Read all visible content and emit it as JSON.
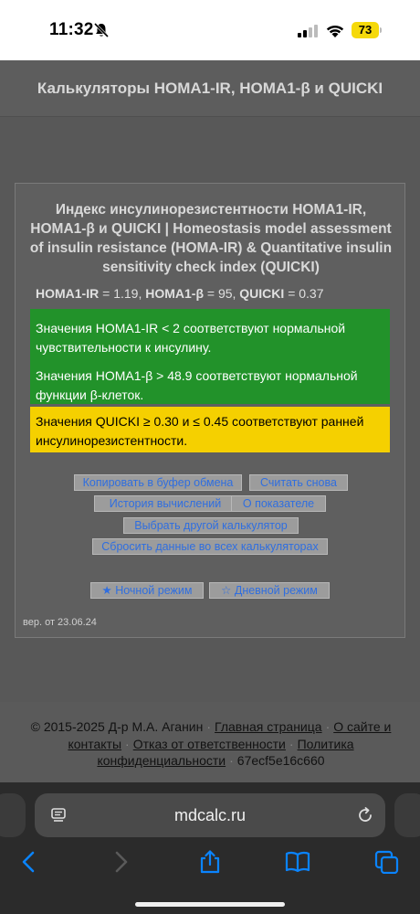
{
  "status": {
    "time": "11:32",
    "battery": "73"
  },
  "header": {
    "title": "Калькуляторы HOMA1-IR, HOMA1-β и QUICKI"
  },
  "calculator": {
    "title": "Индекс инсулинорезистентности HOMA1-IR, HOMA1-β и QUICKI | Homeostasis model assessment of insulin resistance (HOMA-IR) & Quantitative insulin sensitivity check index (QUICKI)",
    "result": {
      "homa_ir_label": "HOMA1-IR",
      "homa_ir_value": "= 1.19,",
      "homa_b_label": "HOMA1-β",
      "homa_b_value": "= 95,",
      "quicki_label": "QUICKI",
      "quicki_value": "= 0.37"
    },
    "messages": {
      "m1": "Значения HOMA1-IR < 2 соответствуют нормальной чувствительности к инсулину.",
      "m2": "Значения HOMA1-β > 48.9 соответствуют нормальной функции β-клеток.",
      "m3": "Значения QUICKI ≥ 0.30 и ≤ 0.45 соответствуют ранней инсулинорезистентности."
    },
    "buttons": {
      "copy": "Копировать в буфер обмена",
      "recalc": "Считать снова",
      "history": "История вычислений",
      "about": "О показателе",
      "other": "Выбрать другой калькулятор",
      "reset": "Сбросить данные во всех калькуляторах",
      "night": "★ Ночной режим",
      "day": "☆ Дневной режим"
    },
    "version": "вер. от 23.06.24"
  },
  "footer": {
    "copyright": "© 2015-2025 Д-р М.А. Аганин",
    "home": "Главная страница",
    "about_contacts": "О сайте и контакты",
    "disclaimer": "Отказ от ответственности",
    "privacy": "Политика конфиденциальности",
    "hash": "67ecf5e16c660"
  },
  "browser": {
    "url": "mdcalc.ru"
  },
  "colors": {
    "green": "#22922a",
    "yellow": "#f5d000",
    "link": "#2f6ee0",
    "ios_blue": "#0a84ff"
  }
}
